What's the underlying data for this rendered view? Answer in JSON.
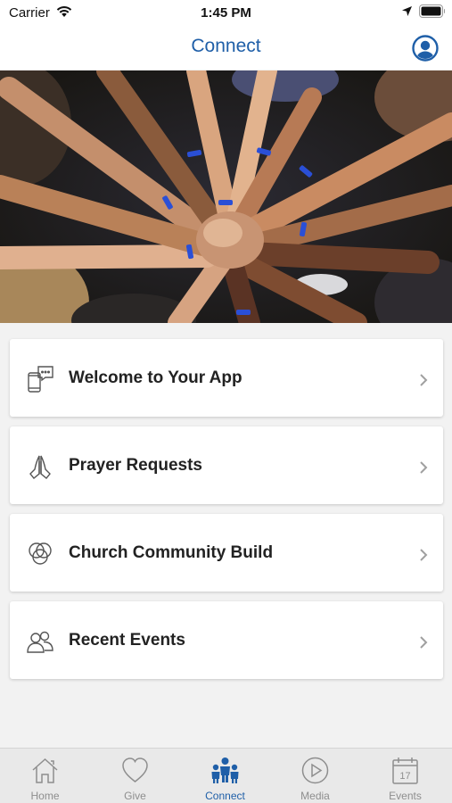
{
  "status_bar": {
    "carrier": "Carrier",
    "time": "1:45 PM"
  },
  "nav": {
    "title": "Connect"
  },
  "menu": {
    "items": [
      {
        "label": "Welcome to Your App",
        "icon": "phone-chat-icon"
      },
      {
        "label": "Prayer Requests",
        "icon": "praying-hands-icon"
      },
      {
        "label": "Church Community Build",
        "icon": "overlapping-circles-icon"
      },
      {
        "label": "Recent Events",
        "icon": "people-icon"
      }
    ]
  },
  "tabs": {
    "items": [
      {
        "label": "Home",
        "icon": "home-icon",
        "active": false
      },
      {
        "label": "Give",
        "icon": "heart-icon",
        "active": false
      },
      {
        "label": "Connect",
        "icon": "group-icon",
        "active": true
      },
      {
        "label": "Media",
        "icon": "play-icon",
        "active": false
      },
      {
        "label": "Events",
        "icon": "calendar-icon",
        "active": false
      }
    ],
    "calendar_day": "17"
  },
  "colors": {
    "accent": "#1f5fa8",
    "inactive": "#8e8e8e",
    "tab_bg": "#e9e9e9"
  }
}
